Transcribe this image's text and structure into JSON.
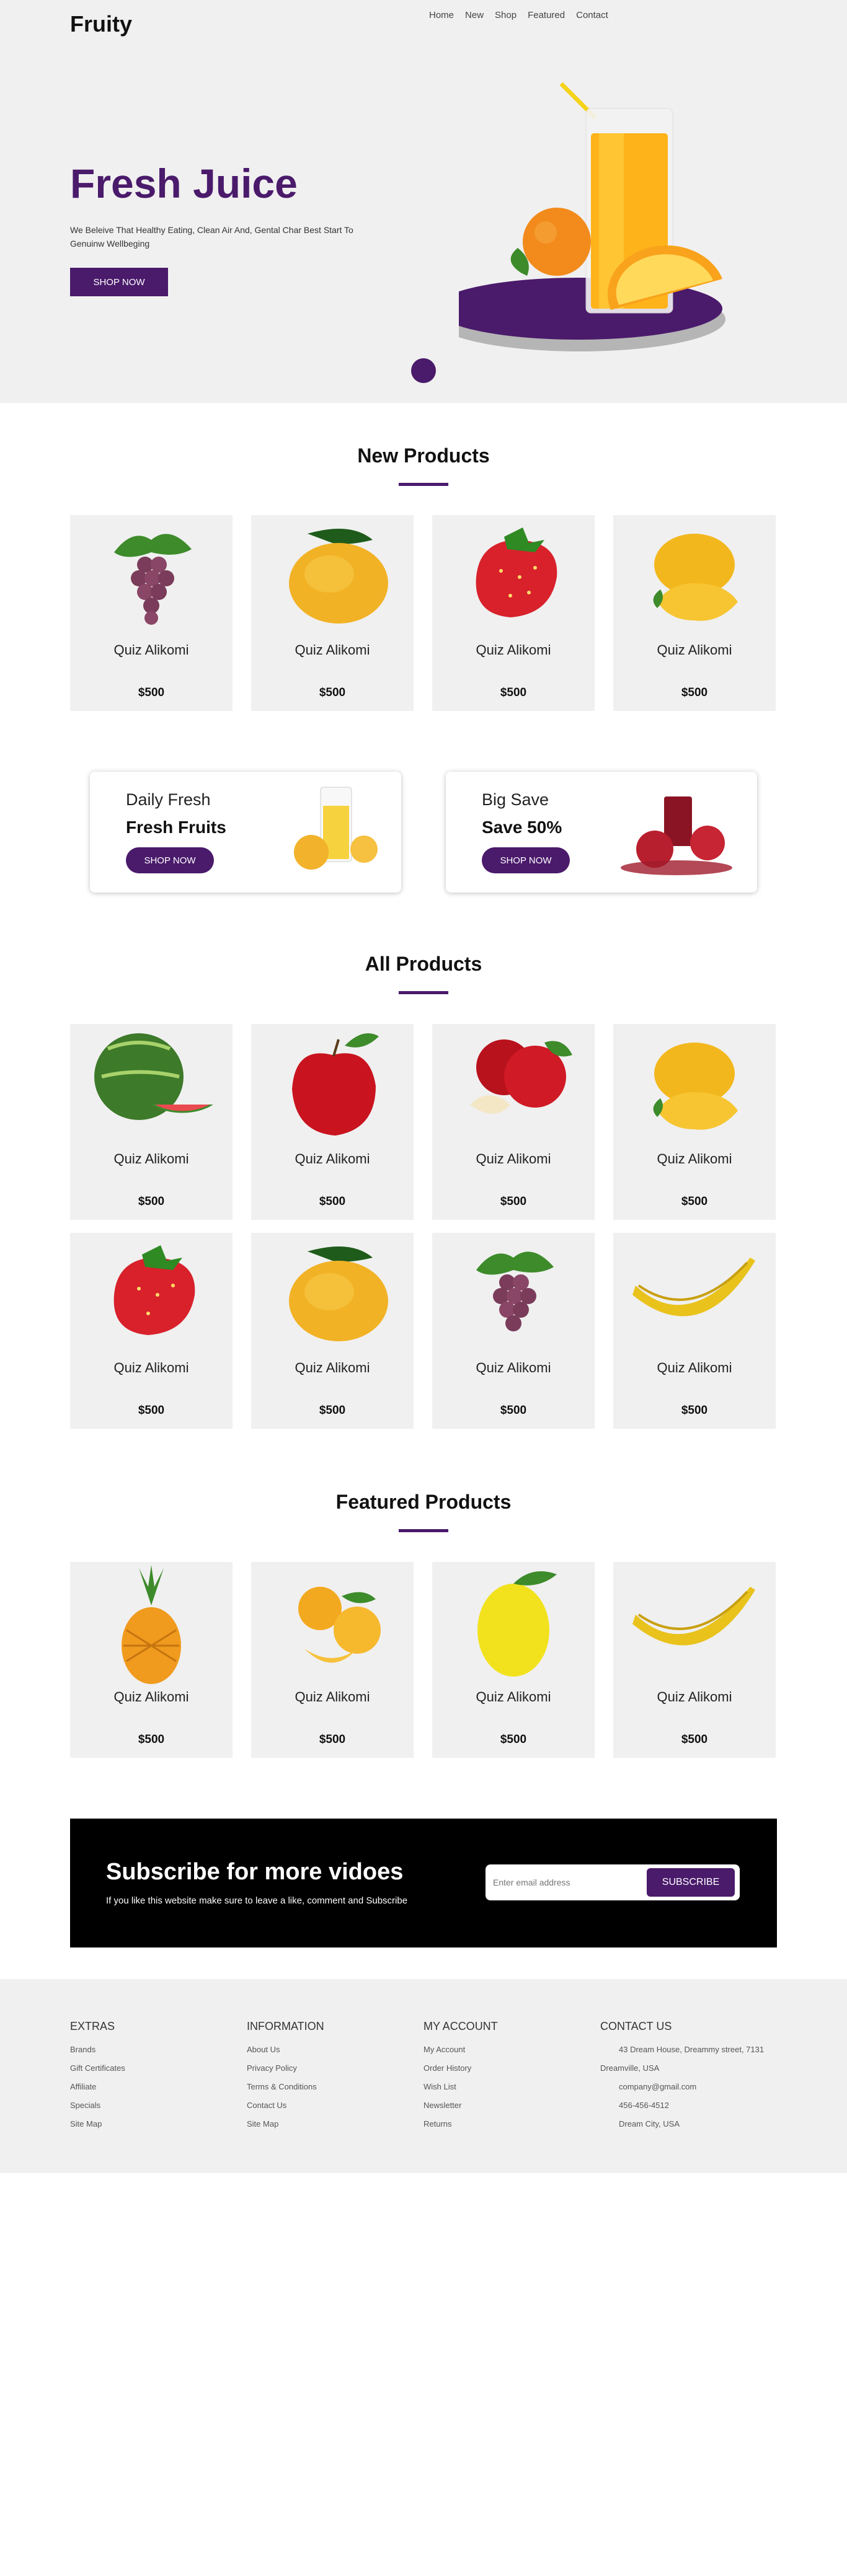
{
  "header": {
    "logo": "Fruity",
    "nav": [
      "Home",
      "New",
      "Shop",
      "Featured",
      "Contact"
    ]
  },
  "hero": {
    "title": "Fresh Juice",
    "tagline": "We Beleive That Healthy Eating, Clean Air And, Gental Char Best Start To Genuinw Wellbeging",
    "button": "SHOP NOW",
    "image_icon": "orange-juice-glass-image"
  },
  "sections": {
    "new_products": "New Products",
    "all_products": "All Products",
    "featured_products": "Featured Products"
  },
  "new_products": [
    {
      "name": "Quiz Alikomi",
      "price": "$500",
      "image": "grapes-image"
    },
    {
      "name": "Quiz Alikomi",
      "price": "$500",
      "image": "mango-image"
    },
    {
      "name": "Quiz Alikomi",
      "price": "$500",
      "image": "strawberry-image"
    },
    {
      "name": "Quiz Alikomi",
      "price": "$500",
      "image": "mango-cut-image"
    }
  ],
  "promos": [
    {
      "small": "Daily Fresh",
      "big": "Fresh Fruits",
      "button": "SHOP NOW",
      "image": "pineapple-juice-image"
    },
    {
      "small": "Big Save",
      "big": "Save 50%",
      "button": "SHOP NOW",
      "image": "pomegranate-juice-image"
    }
  ],
  "all_products": [
    {
      "name": "Quiz Alikomi",
      "price": "$500",
      "image": "watermelon-image"
    },
    {
      "name": "Quiz Alikomi",
      "price": "$500",
      "image": "apple-image"
    },
    {
      "name": "Quiz Alikomi",
      "price": "$500",
      "image": "apples-image"
    },
    {
      "name": "Quiz Alikomi",
      "price": "$500",
      "image": "mango-cut-image"
    },
    {
      "name": "Quiz Alikomi",
      "price": "$500",
      "image": "strawberry-image"
    },
    {
      "name": "Quiz Alikomi",
      "price": "$500",
      "image": "mango-image"
    },
    {
      "name": "Quiz Alikomi",
      "price": "$500",
      "image": "grapes-image"
    },
    {
      "name": "Quiz Alikomi",
      "price": "$500",
      "image": "banana-image"
    }
  ],
  "featured_products": [
    {
      "name": "Quiz Alikomi",
      "price": "$500",
      "image": "pineapple-image"
    },
    {
      "name": "Quiz Alikomi",
      "price": "$500",
      "image": "mangoes-image"
    },
    {
      "name": "Quiz Alikomi",
      "price": "$500",
      "image": "lemon-image"
    },
    {
      "name": "Quiz Alikomi",
      "price": "$500",
      "image": "banana-image"
    }
  ],
  "subscribe": {
    "title": "Subscribe for more vidoes",
    "subtitle": "If you like this website make sure to leave a like, comment and Subscribe",
    "placeholder": "Enter email address",
    "button": "SUBSCRIBE"
  },
  "footer": {
    "extras": {
      "title": "EXTRAS",
      "links": [
        "Brands",
        "Gift Certificates",
        "Affiliate",
        "Specials",
        "Site Map"
      ]
    },
    "information": {
      "title": "INFORMATION",
      "links": [
        "About Us",
        "Privacy Policy",
        "Terms & Conditions",
        "Contact Us",
        "Site Map"
      ]
    },
    "account": {
      "title": "MY ACCOUNT",
      "links": [
        "My Account",
        "Order History",
        "Wish List",
        "Newsletter",
        "Returns"
      ]
    },
    "contact": {
      "title": "CONTACT US",
      "lines": [
        "43 Dream House, Dreammy street, 7131",
        "Dreamville, USA",
        "company@gmail.com",
        "456-456-4512",
        "Dream City, USA"
      ]
    }
  },
  "colors": {
    "accent": "#4a1a6b",
    "card_bg": "#f0f0f0",
    "hero_bg": "#f0f0f0",
    "subscribe_bg": "#000000"
  }
}
